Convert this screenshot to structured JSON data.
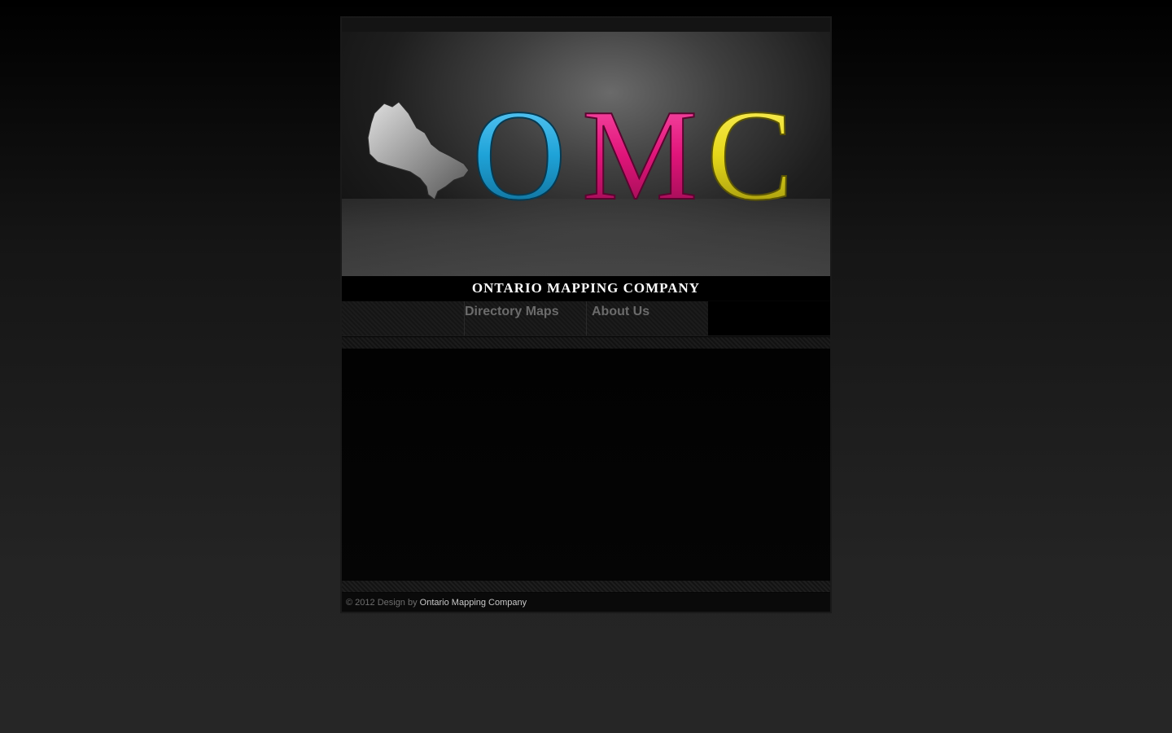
{
  "header": {
    "logo_text": "OMC",
    "company_name": "ONTARIO MAPPING COMPANY"
  },
  "nav": {
    "items": [
      {
        "label": "Directory Maps"
      },
      {
        "label": "About Us"
      }
    ]
  },
  "footer": {
    "copyright": "© 2012 Design by ",
    "link_label": "Ontario Mapping Company"
  },
  "colors": {
    "page_background": "#1e1e1e",
    "logo_o": "#1fa3d8",
    "logo_m": "#e0157a",
    "logo_c": "#e6d81a",
    "nav_text": "#6b6b6b",
    "footer_link": "#c9c9c9"
  }
}
